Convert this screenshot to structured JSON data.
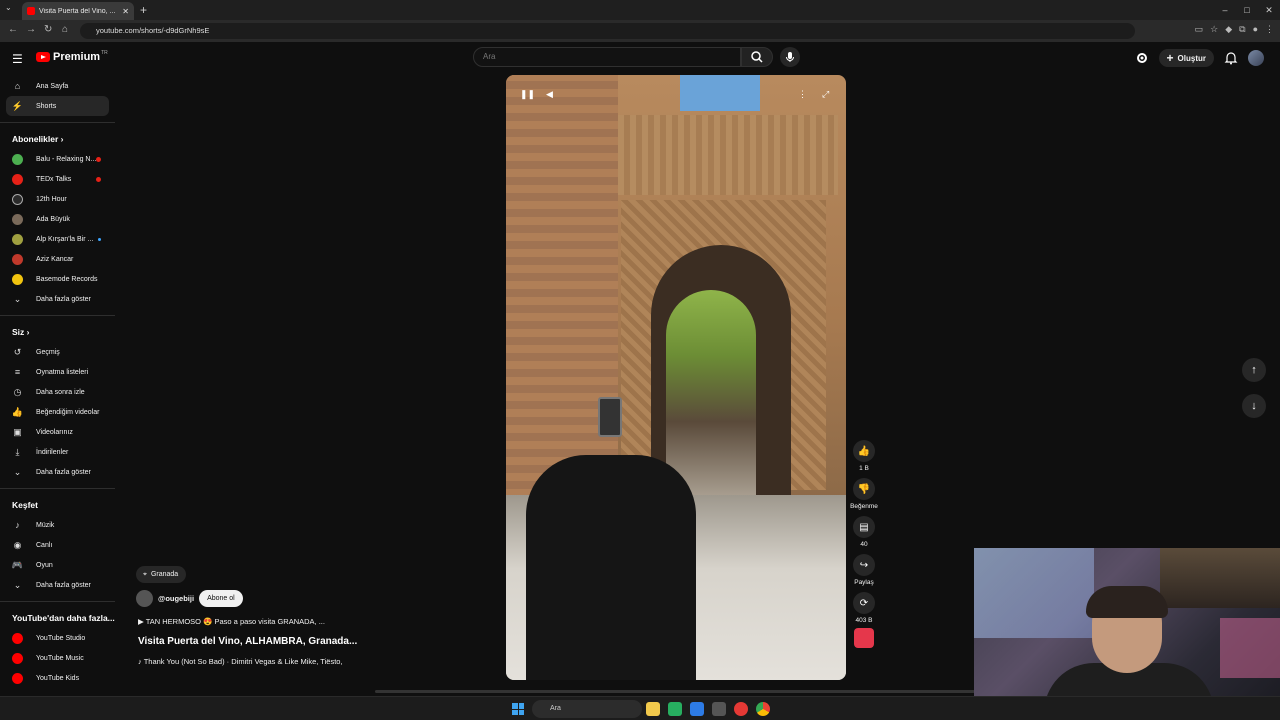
{
  "browser": {
    "tab_title": "Visita Puerta del Vino, ...",
    "url": "youtube.com/shorts/-d9dGrNh9sE"
  },
  "header": {
    "logo_text": "Premium",
    "logo_region": "TR",
    "search_placeholder": "Ara",
    "create_label": "Oluştur"
  },
  "sidebar": {
    "main": [
      {
        "label": "Ana Sayfa",
        "icon": "home-icon"
      },
      {
        "label": "Shorts",
        "icon": "shorts-icon",
        "active": true
      }
    ],
    "subscriptions_title": "Abonelikler",
    "subscriptions": [
      {
        "label": "Balu - Relaxing N...",
        "color": "#4caf50",
        "live": true
      },
      {
        "label": "TEDx Talks",
        "color": "#e62117",
        "live": true
      },
      {
        "label": "12th Hour",
        "color": "#2a2a2a",
        "live": false
      },
      {
        "label": "Ada Büyük",
        "color": "#7a6a5a",
        "live": false
      },
      {
        "label": "Alp Kırşan'la Bir ...",
        "color": "#a0a040",
        "live": false,
        "dot": true
      },
      {
        "label": "Aziz Kancar",
        "color": "#c0392b",
        "live": false
      },
      {
        "label": "Basemode Records",
        "color": "#f1c40f",
        "live": false
      }
    ],
    "subs_more": "Daha fazla göster",
    "you_title": "Siz",
    "you": [
      {
        "label": "Geçmiş",
        "icon": "history-icon"
      },
      {
        "label": "Oynatma listeleri",
        "icon": "playlist-icon"
      },
      {
        "label": "Daha sonra izle",
        "icon": "clock-icon"
      },
      {
        "label": "Beğendiğim videolar",
        "icon": "like-icon"
      },
      {
        "label": "Videolarınız",
        "icon": "video-icon"
      },
      {
        "label": "İndirilenler",
        "icon": "download-icon"
      }
    ],
    "you_more": "Daha fazla göster",
    "explore_title": "Keşfet",
    "explore": [
      {
        "label": "Müzik",
        "icon": "music-icon"
      },
      {
        "label": "Canlı",
        "icon": "live-icon"
      },
      {
        "label": "Oyun",
        "icon": "gaming-icon"
      }
    ],
    "explore_more": "Daha fazla göster",
    "more_title": "YouTube'dan daha fazla...",
    "more": [
      {
        "label": "YouTube Studio"
      },
      {
        "label": "YouTube Music"
      },
      {
        "label": "YouTube Kids"
      }
    ]
  },
  "short": {
    "location": "Granada",
    "channel": "@ougebiji",
    "subscribe_label": "Abone ol",
    "description": "TAN HERMOSO 😍 Paso a paso visita GRANADA, ...",
    "title": "Visita Puerta del Vino, ALHAMBRA, Granada...",
    "music": "Thank You (Not So Bad) · Dimitri Vegas & Like Mike, Tiësto,"
  },
  "actions": {
    "likes": "1 B",
    "dislike_label": "Beğenme",
    "comments": "40",
    "share_label": "Paylaş",
    "remix": "403 B"
  },
  "taskbar": {
    "search_label": "Ara"
  }
}
